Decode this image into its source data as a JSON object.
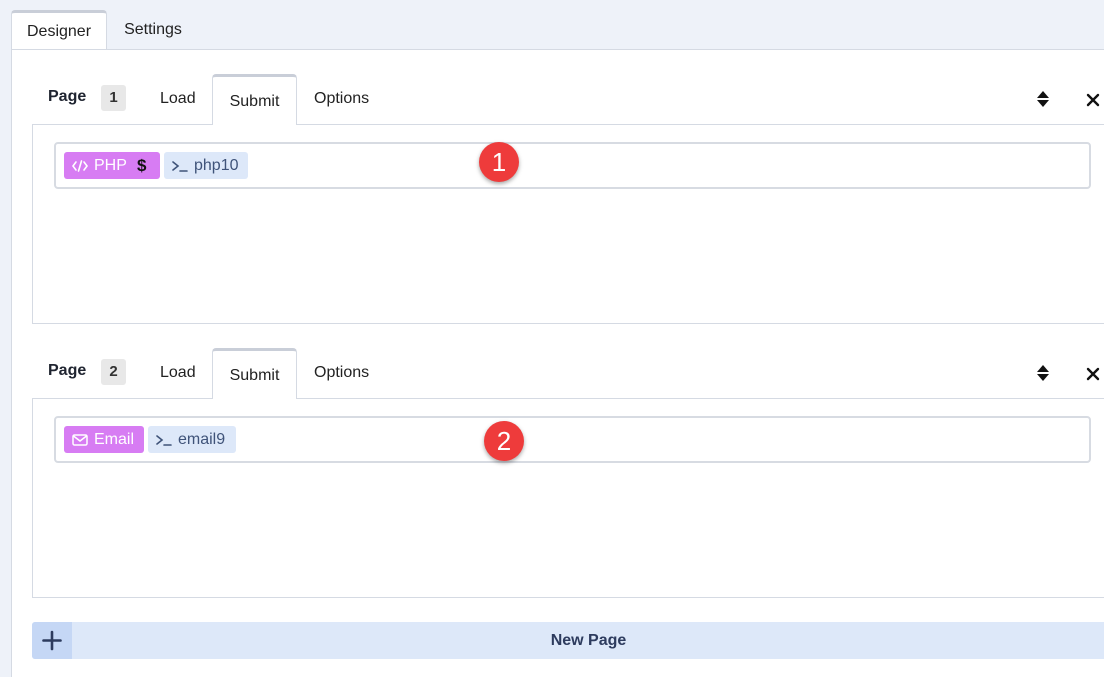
{
  "top_tabs": [
    "Designer",
    "Settings"
  ],
  "pages": [
    {
      "label": "Page",
      "number": "1",
      "tabs": {
        "load": "Load",
        "submit": "Submit",
        "options": "Options"
      },
      "action_chip": {
        "label": "PHP",
        "icon": "code-icon",
        "extra": "$"
      },
      "var_chip": {
        "label": "php10",
        "icon": "terminal-icon"
      },
      "badge": "1"
    },
    {
      "label": "Page",
      "number": "2",
      "tabs": {
        "load": "Load",
        "submit": "Submit",
        "options": "Options"
      },
      "action_chip": {
        "label": "Email",
        "icon": "envelope-icon"
      },
      "var_chip": {
        "label": "email9",
        "icon": "terminal-icon"
      },
      "badge": "2"
    }
  ],
  "new_page": {
    "label": "New Page",
    "icon": "plus-icon"
  },
  "colors": {
    "action_chip": "#d77cf3",
    "var_chip": "#dde8f9",
    "badge": "#ee3b3b"
  }
}
